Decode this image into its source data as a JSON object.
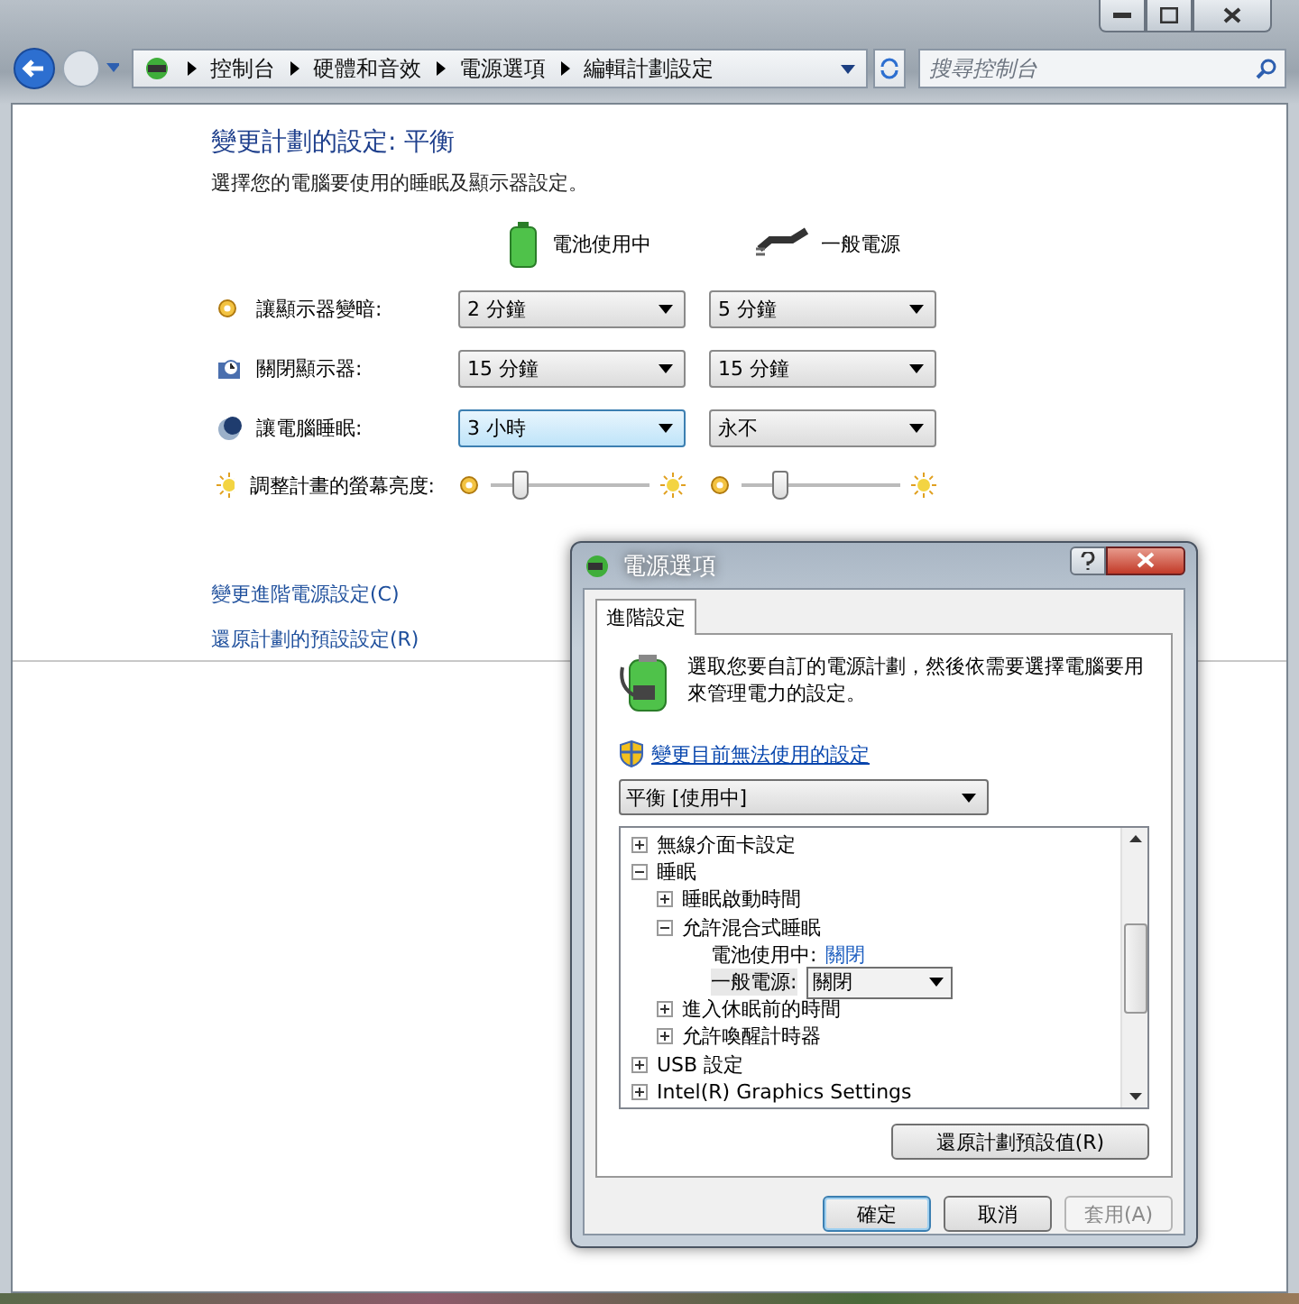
{
  "address_bar": {
    "crumbs": [
      "控制台",
      "硬體和音效",
      "電源選項",
      "編輯計劃設定"
    ],
    "search": {
      "placeholder": "搜尋控制台"
    }
  },
  "page": {
    "title": "變更計劃的設定: 平衡",
    "subtitle": "選擇您的電腦要使用的睡眠及顯示器設定。",
    "columns": [
      {
        "kind": "battery",
        "label": "電池使用中"
      },
      {
        "kind": "plug",
        "label": "一般電源"
      }
    ],
    "settings": [
      {
        "kind": "select",
        "label": "讓顯示器變暗:",
        "values": [
          {
            "value": "2 分鐘",
            "focused": false
          },
          {
            "value": "5 分鐘",
            "focused": false
          }
        ]
      },
      {
        "kind": "select",
        "label": "關閉顯示器:",
        "values": [
          {
            "value": "15 分鐘",
            "focused": false
          },
          {
            "value": "15 分鐘",
            "focused": false
          }
        ]
      },
      {
        "kind": "select",
        "label": "讓電腦睡眠:",
        "values": [
          {
            "value": "3 小時",
            "focused": true
          },
          {
            "value": "永不",
            "focused": false
          }
        ]
      },
      {
        "kind": "slider",
        "label": "調整計畫的螢幕亮度:",
        "values": [
          {
            "level": 0.18
          },
          {
            "level": 0.24
          }
        ]
      }
    ],
    "links": [
      "變更進階電源設定(C)",
      "還原計劃的預設設定(R)"
    ]
  },
  "dialog": {
    "title": "電源選項",
    "tabs": [
      {
        "label": "進階設定",
        "selected": true
      }
    ],
    "description": "選取您要自訂的電源計劃，然後依需要選擇電腦要用來管理電力的設定。",
    "shield_link": "變更目前無法使用的設定",
    "plan": "平衡 [使用中]",
    "tree": [
      {
        "kind": "node",
        "label": "無線介面卡設定",
        "expanded": false
      },
      {
        "kind": "node",
        "label": "睡眠",
        "expanded": true,
        "children": [
          {
            "kind": "node",
            "label": "睡眠啟動時間",
            "expanded": false
          },
          {
            "kind": "node",
            "label": "允許混合式睡眠",
            "expanded": true,
            "children": [
              {
                "kind": "link",
                "label": "電池使用中:",
                "value": "關閉"
              },
              {
                "kind": "select",
                "label": "一般電源:",
                "value": "關閉"
              }
            ]
          },
          {
            "kind": "node",
            "label": "進入休眠前的時間",
            "expanded": false
          },
          {
            "kind": "node",
            "label": "允許喚醒計時器",
            "expanded": false
          }
        ]
      },
      {
        "kind": "node",
        "label": "USB 設定",
        "expanded": false
      },
      {
        "kind": "node",
        "label": "Intel(R) Graphics Settings",
        "expanded": false
      }
    ],
    "restore_button": "還原計劃預設值(R)",
    "buttons": [
      {
        "label": "確定",
        "default": true,
        "disabled": false
      },
      {
        "label": "取消",
        "default": false,
        "disabled": false
      },
      {
        "label": "套用(A)",
        "default": false,
        "disabled": true
      }
    ]
  }
}
